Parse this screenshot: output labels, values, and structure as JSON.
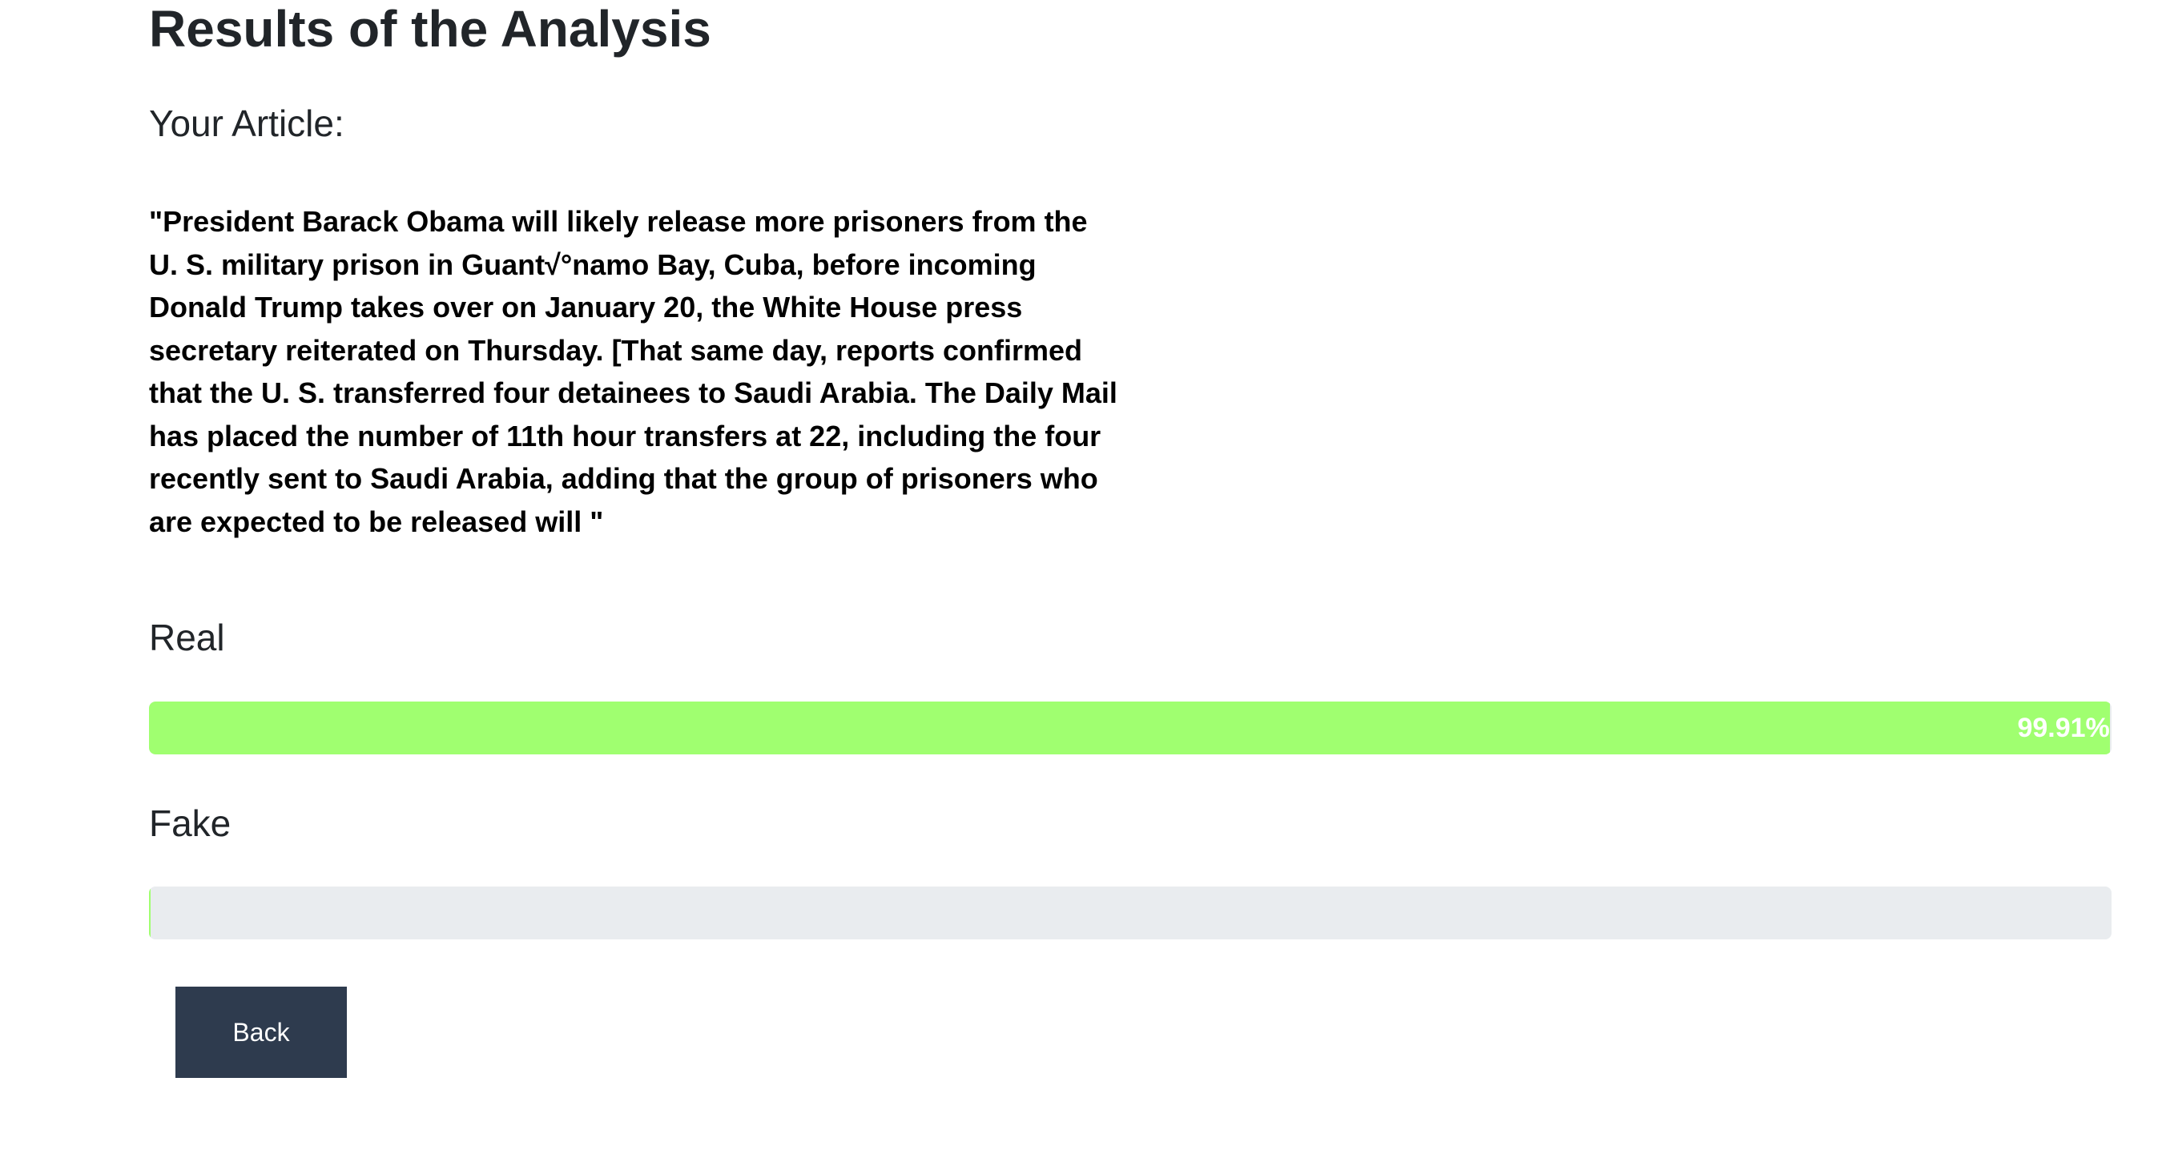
{
  "page": {
    "title": "Results of the Analysis",
    "article_heading": "Your Article:",
    "article_text": "\"President Barack Obama will likely release more prisoners from the U. S. military prison in Guant√°namo Bay, Cuba, before incoming Donald Trump takes over on January 20, the White House press secretary reiterated on Thursday. [That same day, reports confirmed that the U. S. transferred four detainees to Saudi Arabia. The Daily Mail has placed the number of 11th hour transfers at 22, including the four recently sent to Saudi Arabia, adding that the group of prisoners who are expected to be released will \""
  },
  "results": {
    "real": {
      "label": "Real",
      "percent": 99.91,
      "percent_text": "99.91%",
      "color": "#a0ff70"
    },
    "fake": {
      "label": "Fake",
      "percent": 0.09,
      "percent_text": "",
      "color": "#a0ff70"
    }
  },
  "actions": {
    "back_label": "Back"
  },
  "colors": {
    "track": "#e9ecef",
    "button": "#2e3b4e",
    "text": "#212529"
  }
}
